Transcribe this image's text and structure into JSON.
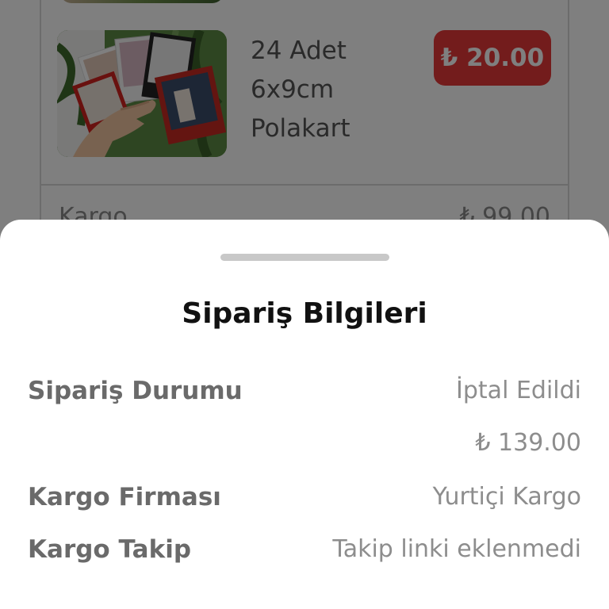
{
  "background_page": {
    "product": {
      "name": "24 Adet\n6x9cm\nPolakart",
      "price": "₺ 20.00"
    },
    "shipping_row": {
      "label": "Kargo",
      "value": "₺ 99.00"
    },
    "colors": {
      "price_badge": "#e63939",
      "card_border": "#d8d8d8"
    }
  },
  "sheet": {
    "title": "Sipariş Bilgileri",
    "rows": [
      {
        "label": "Sipariş Durumu",
        "value": "İptal Edildi"
      },
      {
        "label": "",
        "value": "₺ 139.00"
      },
      {
        "label": "Kargo Firması",
        "value": "Yurtiçi Kargo"
      },
      {
        "label": "Kargo Takip",
        "value": "Takip linki eklenmedi"
      }
    ]
  },
  "overlay_color": "#000000"
}
